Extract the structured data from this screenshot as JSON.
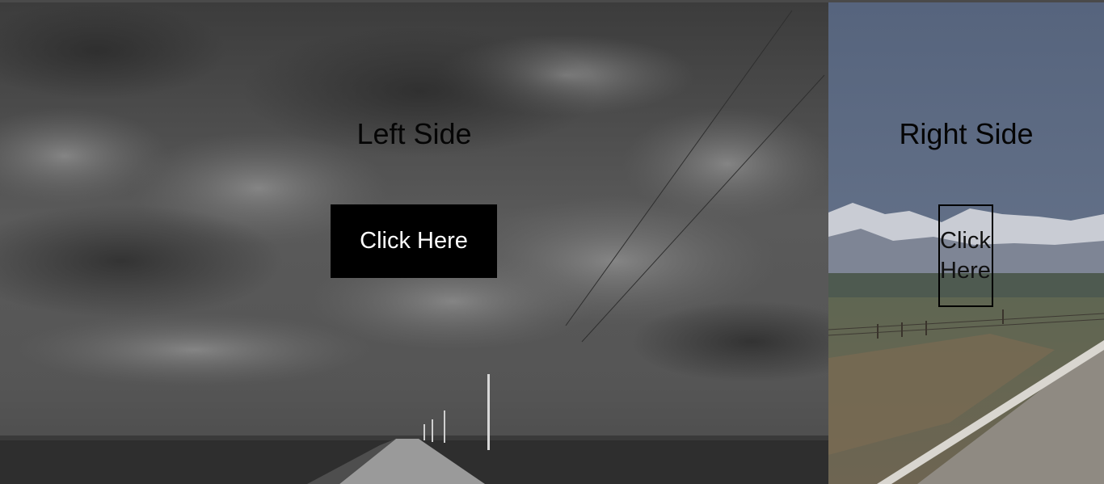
{
  "left_panel": {
    "title": "Left Side",
    "button_label": "Click Here",
    "background": "grayscale photo of stormy cloudy sky over a straight rural road with utility poles",
    "colors": {
      "button_bg": "#000000",
      "button_text": "#ffffff"
    }
  },
  "right_panel": {
    "title": "Right Side",
    "button_label": "Click Here",
    "background": "muted color photo of snowy mountains, blue sky, grassy field with fence and a paved road",
    "colors": {
      "button_border": "#000000",
      "button_text": "#111111"
    }
  }
}
